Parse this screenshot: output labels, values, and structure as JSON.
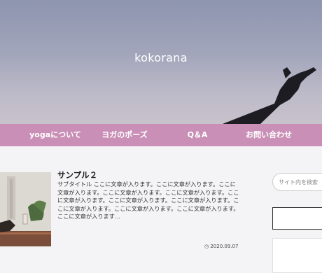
{
  "site": {
    "title": "kokorana"
  },
  "nav": {
    "items": [
      {
        "label": "yogaについて"
      },
      {
        "label": "ヨガのポーズ"
      },
      {
        "label": "Q＆A"
      },
      {
        "label": "お問い合わせ"
      }
    ]
  },
  "post": {
    "title": "サンプル２",
    "excerpt": "サブタイトル ここに文章が入ります。ここに文章が入ります。ここに文章が入ります。ここに文章が入ります。ここに文章が入ります。ここに文章が入ります。ここに文章が入ります。ここに文章が入ります。ここに文章が入ります。ここに文章が入ります。ここに文章が入ります。ここに文章が入ります…",
    "date": "2020.09.07"
  },
  "sidebar": {
    "search_placeholder": "サイト内を検索"
  },
  "colors": {
    "nav_bg": "#c98fb6",
    "hero_sky": "#9aa0b8"
  }
}
